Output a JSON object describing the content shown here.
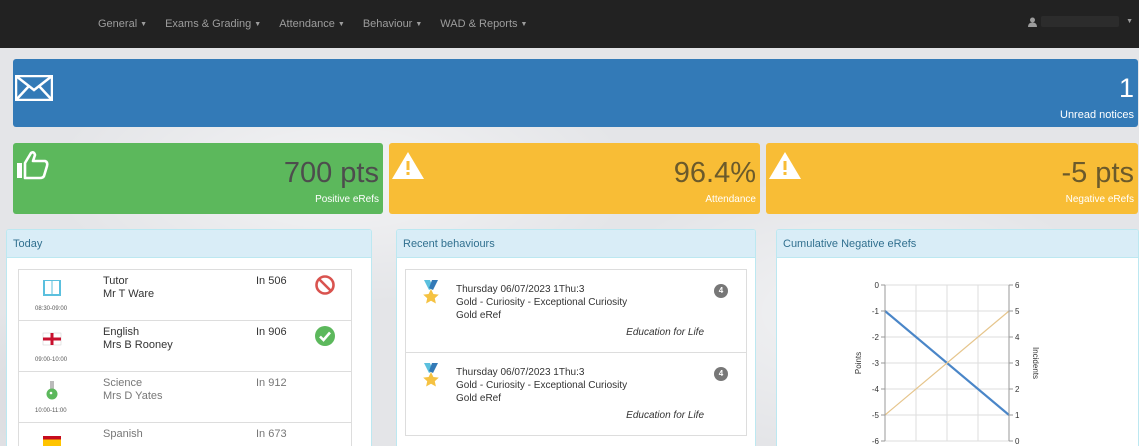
{
  "nav": {
    "brand": "",
    "items": [
      {
        "label": "General"
      },
      {
        "label": "Exams & Grading"
      },
      {
        "label": "Attendance"
      },
      {
        "label": "Behaviour"
      },
      {
        "label": "WAD & Reports"
      }
    ],
    "user_name": ""
  },
  "notice": {
    "count": "1",
    "label": "Unread notices"
  },
  "tiles": {
    "positive": {
      "value": "700 pts",
      "label": "Positive eRefs"
    },
    "attendance": {
      "value": "96.4%",
      "label": "Attendance"
    },
    "negative": {
      "value": "-5 pts",
      "label": "Negative eRefs"
    }
  },
  "colors": {
    "primary": "#337ab7",
    "success": "#5cb85c",
    "warning": "#f8bd36",
    "navbar": "#222222",
    "panel_head": "#d9edf7"
  },
  "today": {
    "title": "Today",
    "lessons": [
      {
        "time": "08:30-09:00",
        "subject": "Tutor",
        "teacher": "Mr T Ware",
        "room": "In 506",
        "icon": "book-icon",
        "status": "absent-icon"
      },
      {
        "time": "09:00-10:00",
        "subject": "English",
        "teacher": "Mrs B Rooney",
        "room": "In 906",
        "icon": "england-flag-icon",
        "status": "present-check-icon"
      },
      {
        "time": "10:00-11:00",
        "subject": "Science",
        "teacher": "Mrs D Yates",
        "room": "In 912",
        "icon": "flask-icon",
        "status": ""
      },
      {
        "time": "",
        "subject": "Spanish",
        "teacher": "",
        "room": "In 673",
        "icon": "spain-flag-icon",
        "status": ""
      }
    ]
  },
  "recent": {
    "title": "Recent behaviours",
    "items": [
      {
        "date": "Thursday 06/07/2023 1Thu:3",
        "desc": "Gold - Curiosity - Exceptional Curiosity",
        "type": "Gold eRef",
        "tag": "Education for Life",
        "badge": "4",
        "icon": "medal-icon"
      },
      {
        "date": "Thursday 06/07/2023 1Thu:3",
        "desc": "Gold - Curiosity - Exceptional Curiosity",
        "type": "Gold eRef",
        "tag": "Education for Life",
        "badge": "4",
        "icon": "medal-icon"
      }
    ]
  },
  "chart_data": {
    "type": "line",
    "title": "Cumulative Negative eRefs",
    "ylabel": "Points",
    "y2label": "Incidents",
    "ylim": [
      -6,
      0
    ],
    "y2lim": [
      0,
      6
    ],
    "yticks": [
      "0",
      "-1",
      "-2",
      "-3",
      "-4",
      "-5",
      "-6"
    ],
    "y2ticks": [
      "6",
      "5",
      "4",
      "3",
      "2",
      "1",
      "0"
    ],
    "x": [
      0,
      1
    ],
    "series": [
      {
        "name": "Points",
        "axis": "left",
        "values": [
          -1,
          -5
        ],
        "color": "#4a86c8"
      },
      {
        "name": "Incidents",
        "axis": "right",
        "values": [
          1,
          5
        ],
        "color": "#e6c58c"
      }
    ],
    "grid": true
  }
}
